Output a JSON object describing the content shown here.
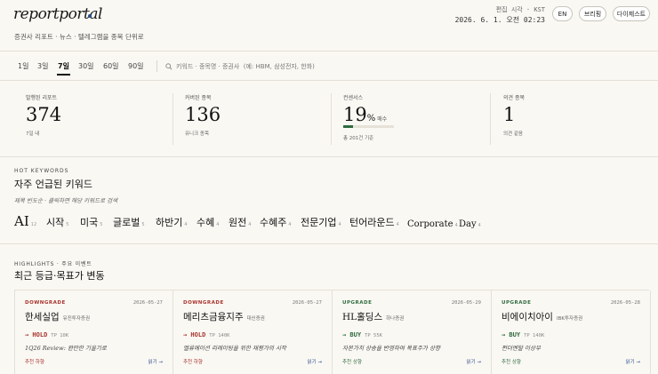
{
  "header": {
    "logo": "reportportal",
    "tagline": "증권사 리포트 · 뉴스 · 텔레그램을 종목 단위로",
    "time_label": "편집 시각 · KST",
    "time_value": "2026. 6. 1. 오전 02:23",
    "lang_button": "EN",
    "briefing_button": "브리핑",
    "digest_button": "다이제스트",
    "colors": {
      "logo_dot": "#2c4f8c"
    }
  },
  "filters": {
    "ranges": [
      "1일",
      "3일",
      "7일",
      "30일",
      "60일",
      "90일"
    ],
    "active_range": "7일",
    "search_placeholder": "키워드 · 종목명 · 증권사  (예: HBM, 삼성전자, 한화)"
  },
  "stats": [
    {
      "label": "발행된 리포트",
      "value": "374",
      "sub": "7일 내"
    },
    {
      "label": "커버된 종목",
      "value": "136",
      "sub": "유니크 종목"
    },
    {
      "label": "컨센서스",
      "value": "19",
      "unit": "%",
      "unit_suffix": "매수",
      "sub": "총 201건 기준",
      "progress_percent": 19
    },
    {
      "label": "의견 종목",
      "value": "1",
      "sub": "의견 같음"
    }
  ],
  "keywords": {
    "eyebrow": "HOT KEYWORDS",
    "title": "자주 언급된 키워드",
    "description": "제목 빈도순 · 클릭하면 해당 키워드로 검색",
    "items": [
      {
        "text": "AI",
        "count": "12"
      },
      {
        "text": "시작",
        "count": "5"
      },
      {
        "text": "미국",
        "count": "5"
      },
      {
        "text": "글로벌",
        "count": "5"
      },
      {
        "text": "하반기",
        "count": "4"
      },
      {
        "text": "수혜",
        "count": "4"
      },
      {
        "text": "원전",
        "count": "4"
      },
      {
        "text": "수혜주",
        "count": "4"
      },
      {
        "text": "전문기업",
        "count": "4"
      },
      {
        "text": "턴어라운드",
        "count": "4"
      },
      {
        "text": "Corporate",
        "count": "4"
      },
      {
        "text": "Day",
        "count": "4"
      }
    ]
  },
  "highlights": {
    "eyebrow": "HIGHLIGHTS · 주요 이벤트",
    "title": "최근 등급·목표가 변동",
    "cards": [
      {
        "type": "DOWNGRADE",
        "date": "2026-05-27",
        "company": "한세실업",
        "broker": "유진투자증권",
        "rating": "→ HOLD",
        "tp": "TP 10K",
        "summary": "1Q26 Review: 완만한 기울기로",
        "trend": "추천 하향",
        "read": "읽기 →",
        "color": "#a8322d"
      },
      {
        "type": "DOWNGRADE",
        "date": "2026-05-27",
        "company": "메리츠금융지주",
        "broker": "대신증권",
        "rating": "→ HOLD",
        "tp": "TP 140K",
        "summary": "밸류에이션 리레이팅을 위한 재평가의 시작",
        "trend": "추천 하향",
        "read": "읽기 →",
        "color": "#a8322d"
      },
      {
        "type": "UPGRADE",
        "date": "2026-05-29",
        "company": "HL홀딩스",
        "broker": "하나증권",
        "rating": "→ BUY",
        "tp": "TP 55K",
        "summary": "자본가치 상승을 반영하여 목표주가 상향",
        "trend": "추천 상향",
        "read": "읽기 →",
        "color": "#2f6b3f"
      },
      {
        "type": "UPGRADE",
        "date": "2026-05-28",
        "company": "비에이치아이",
        "broker": "IBK투자증권",
        "rating": "→ BUY",
        "tp": "TP 140K",
        "summary": "펀더멘탈 이상무",
        "trend": "추천 상향",
        "read": "읽기 →",
        "color": "#2f6b3f"
      }
    ]
  }
}
